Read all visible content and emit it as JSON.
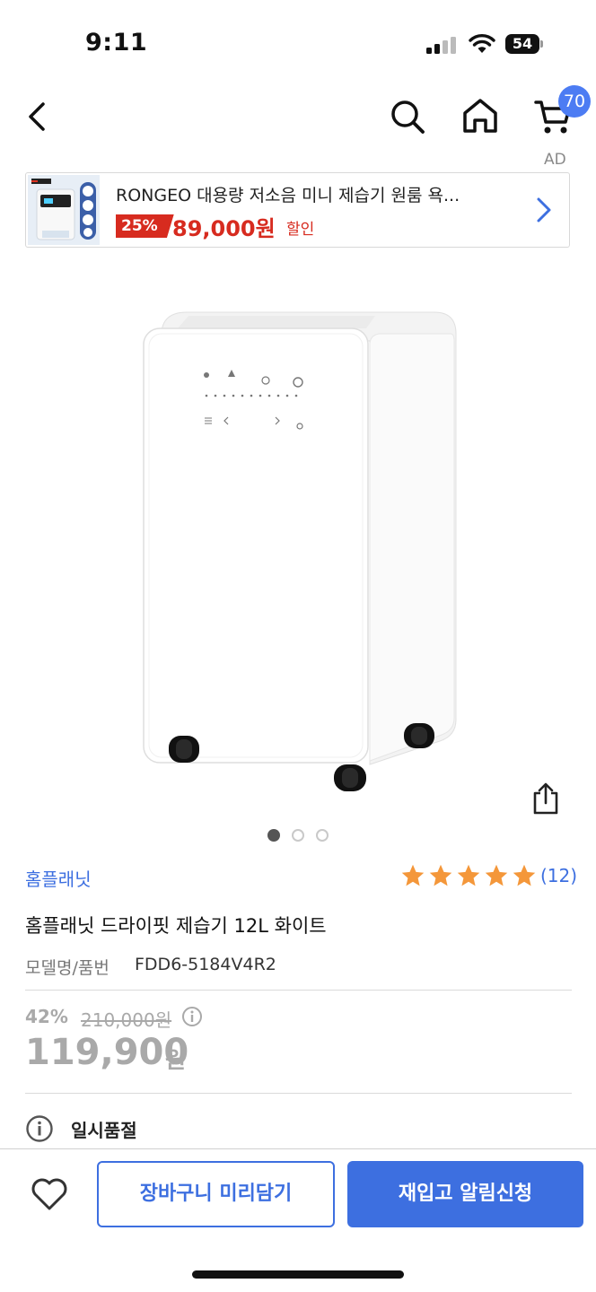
{
  "status_bar": {
    "time": "9:11",
    "battery": "54"
  },
  "nav": {
    "cart_count": "70"
  },
  "ad": {
    "label": "AD",
    "title": "RONGEO 대용량 저소음 미니 제습기 원룸 욕...",
    "discount": "25%",
    "price": "89,000원",
    "sale_label": "할인"
  },
  "product": {
    "brand": "홈플래닛",
    "rating": 5,
    "review_count": "(12)",
    "name": "홈플래닛 드라이핏 제습기 12L 화이트",
    "model_label": "모델명/품번",
    "model_value": "FDD6-5184V4R2",
    "discount_pct": "42%",
    "original_price": "210,000원",
    "price": "119,900",
    "price_unit": "원",
    "status": "일시품절"
  },
  "gallery": {
    "total": 3,
    "current": 1
  },
  "bottom": {
    "cart_button": "장바구니 미리담기",
    "restock_button": "재입고 알림신청"
  },
  "colors": {
    "accent": "#3d6fe0",
    "sale_red": "#d72b1f",
    "muted": "#a9a9a9"
  }
}
